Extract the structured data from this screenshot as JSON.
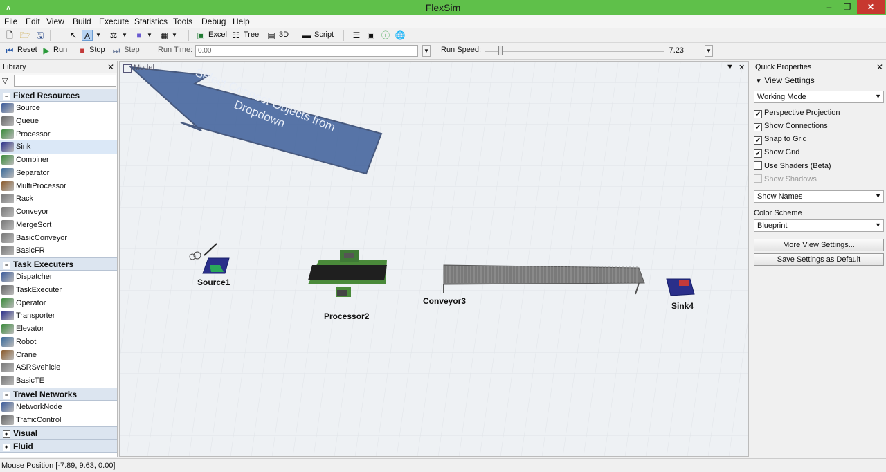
{
  "window": {
    "title": "FlexSim"
  },
  "menu": [
    "File",
    "Edit",
    "View",
    "Build",
    "Execute",
    "Statistics",
    "Tools",
    "Debug",
    "Help"
  ],
  "toolbar": {
    "excel_label": "Excel",
    "tree_label": "Tree",
    "threed_label": "3D",
    "script_label": "Script"
  },
  "runbar": {
    "reset_label": "Reset",
    "run_label": "Run",
    "stop_label": "Stop",
    "step_label": "Step",
    "run_time_label": "Run Time:",
    "run_time_value": "0.00",
    "run_speed_label": "Run Speed:",
    "run_speed_value": "7.23",
    "run_speed_fraction": 0.09
  },
  "library": {
    "title": "Library",
    "groups": [
      {
        "name": "Fixed Resources",
        "expanded": true,
        "items": [
          "Source",
          "Queue",
          "Processor",
          "Sink",
          "Combiner",
          "Separator",
          "MultiProcessor",
          "Rack",
          "Conveyor",
          "MergeSort",
          "BasicConveyor",
          "BasicFR"
        ]
      },
      {
        "name": "Task Executers",
        "expanded": true,
        "items": [
          "Dispatcher",
          "TaskExecuter",
          "Operator",
          "Transporter",
          "Elevator",
          "Robot",
          "Crane",
          "ASRSvehicle",
          "BasicTE"
        ]
      },
      {
        "name": "Travel Networks",
        "expanded": true,
        "items": [
          "NetworkNode",
          "TrafficControl"
        ]
      },
      {
        "name": "Visual",
        "expanded": false,
        "items": []
      },
      {
        "name": "Fluid",
        "expanded": false,
        "items": []
      }
    ],
    "selected_item": "Sink"
  },
  "model": {
    "tab_label": "Model",
    "callout": "Select Connect Objects from Dropdown",
    "objects": {
      "source": "Source1",
      "processor": "Processor2",
      "conveyor": "Conveyor3",
      "sink": "Sink4"
    }
  },
  "quick_properties": {
    "title": "Quick Properties",
    "section": "View Settings",
    "mode_select": "Working Mode",
    "checks": {
      "perspective": {
        "label": "Perspective Projection",
        "checked": true
      },
      "connections": {
        "label": "Show Connections",
        "checked": true
      },
      "snap": {
        "label": "Snap to Grid",
        "checked": true
      },
      "grid": {
        "label": "Show Grid",
        "checked": true
      },
      "shaders": {
        "label": "Use Shaders (Beta)",
        "checked": false
      },
      "shadows": {
        "label": "Show Shadows",
        "checked": false
      }
    },
    "names_select": "Show Names",
    "color_scheme_label": "Color Scheme",
    "color_scheme_value": "Blueprint",
    "more_settings_label": "More View Settings...",
    "save_default_label": "Save Settings as Default"
  },
  "status": {
    "mouse_position": "Mouse Position [-7.89, 9.63, 0.00]"
  },
  "colors": {
    "titlebar": "#5fc04a",
    "close": "#c7382f",
    "group_header": "#dce5f0",
    "callout": "#3d5f9a"
  }
}
